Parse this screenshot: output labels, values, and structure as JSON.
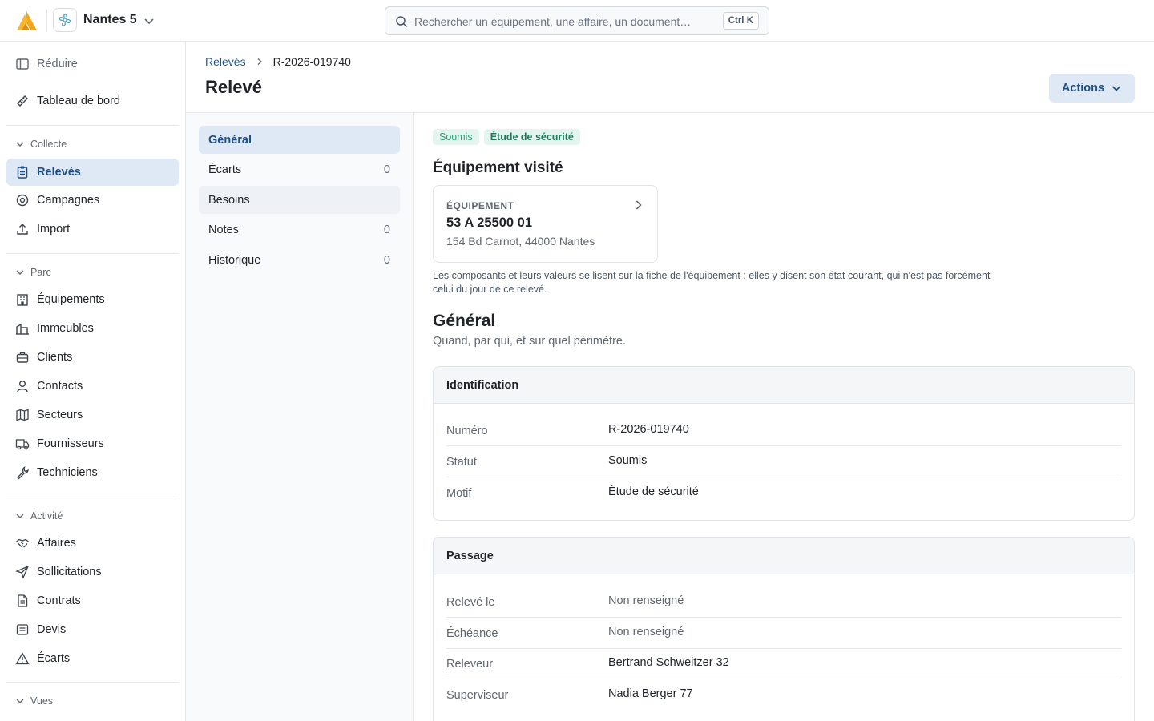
{
  "topbar": {
    "org_name": "Nantes 5",
    "search_placeholder": "Rechercher un équipement, une affaire, un document…",
    "search_shortcut": "Ctrl K"
  },
  "sidebar": {
    "collapse_label": "Réduire",
    "dashboard_label": "Tableau de bord",
    "groups": {
      "collecte": "Collecte",
      "parc": "Parc",
      "activite": "Activité",
      "vues": "Vues"
    },
    "collecte_items": [
      "Relevés",
      "Campagnes",
      "Import"
    ],
    "parc_items": [
      "Équipements",
      "Immeubles",
      "Clients",
      "Contacts",
      "Secteurs",
      "Fournisseurs",
      "Techniciens"
    ],
    "activite_items": [
      "Affaires",
      "Sollicitations",
      "Contrats",
      "Devis",
      "Écarts"
    ]
  },
  "breadcrumb": {
    "parent": "Relevés",
    "current": "R-2026-019740"
  },
  "page": {
    "title": "Relevé",
    "actions_label": "Actions"
  },
  "subnav": [
    {
      "label": "Général",
      "count": ""
    },
    {
      "label": "Écarts",
      "count": "0"
    },
    {
      "label": "Besoins",
      "count": ""
    },
    {
      "label": "Notes",
      "count": "0"
    },
    {
      "label": "Historique",
      "count": "0"
    }
  ],
  "badges": {
    "status": "Soumis",
    "motif": "Étude de sécurité"
  },
  "equipment": {
    "section_title": "Équipement visité",
    "kicker": "ÉQUIPEMENT",
    "number": "53 A 25500 01",
    "address": "154 Bd Carnot, 44000 Nantes",
    "note": "Les composants et leurs valeurs se lisent sur la fiche de l'équipement : elles y disent son état courant, qui n'est pas forcément celui du jour de ce relevé."
  },
  "general": {
    "title": "Général",
    "subtitle": "Quand, par qui, et sur quel périmètre."
  },
  "identification": {
    "title": "Identification",
    "rows": [
      {
        "key": "Numéro",
        "value": "R-2026-019740"
      },
      {
        "key": "Statut",
        "value": "Soumis"
      },
      {
        "key": "Motif",
        "value": "Étude de sécurité"
      }
    ]
  },
  "passage": {
    "title": "Passage",
    "rows": [
      {
        "key": "Relevé le",
        "value": "Non renseigné"
      },
      {
        "key": "Échéance",
        "value": "Non renseigné"
      },
      {
        "key": "Releveur",
        "value": "Bertrand Schweitzer 32"
      },
      {
        "key": "Superviseur",
        "value": "Nadia Berger 77"
      }
    ]
  },
  "colors": {
    "accent": "#1e4f86",
    "accent_bg": "#dfe9f6",
    "logo": "#f2a516",
    "badge_green_bg": "#e4f5ef"
  }
}
